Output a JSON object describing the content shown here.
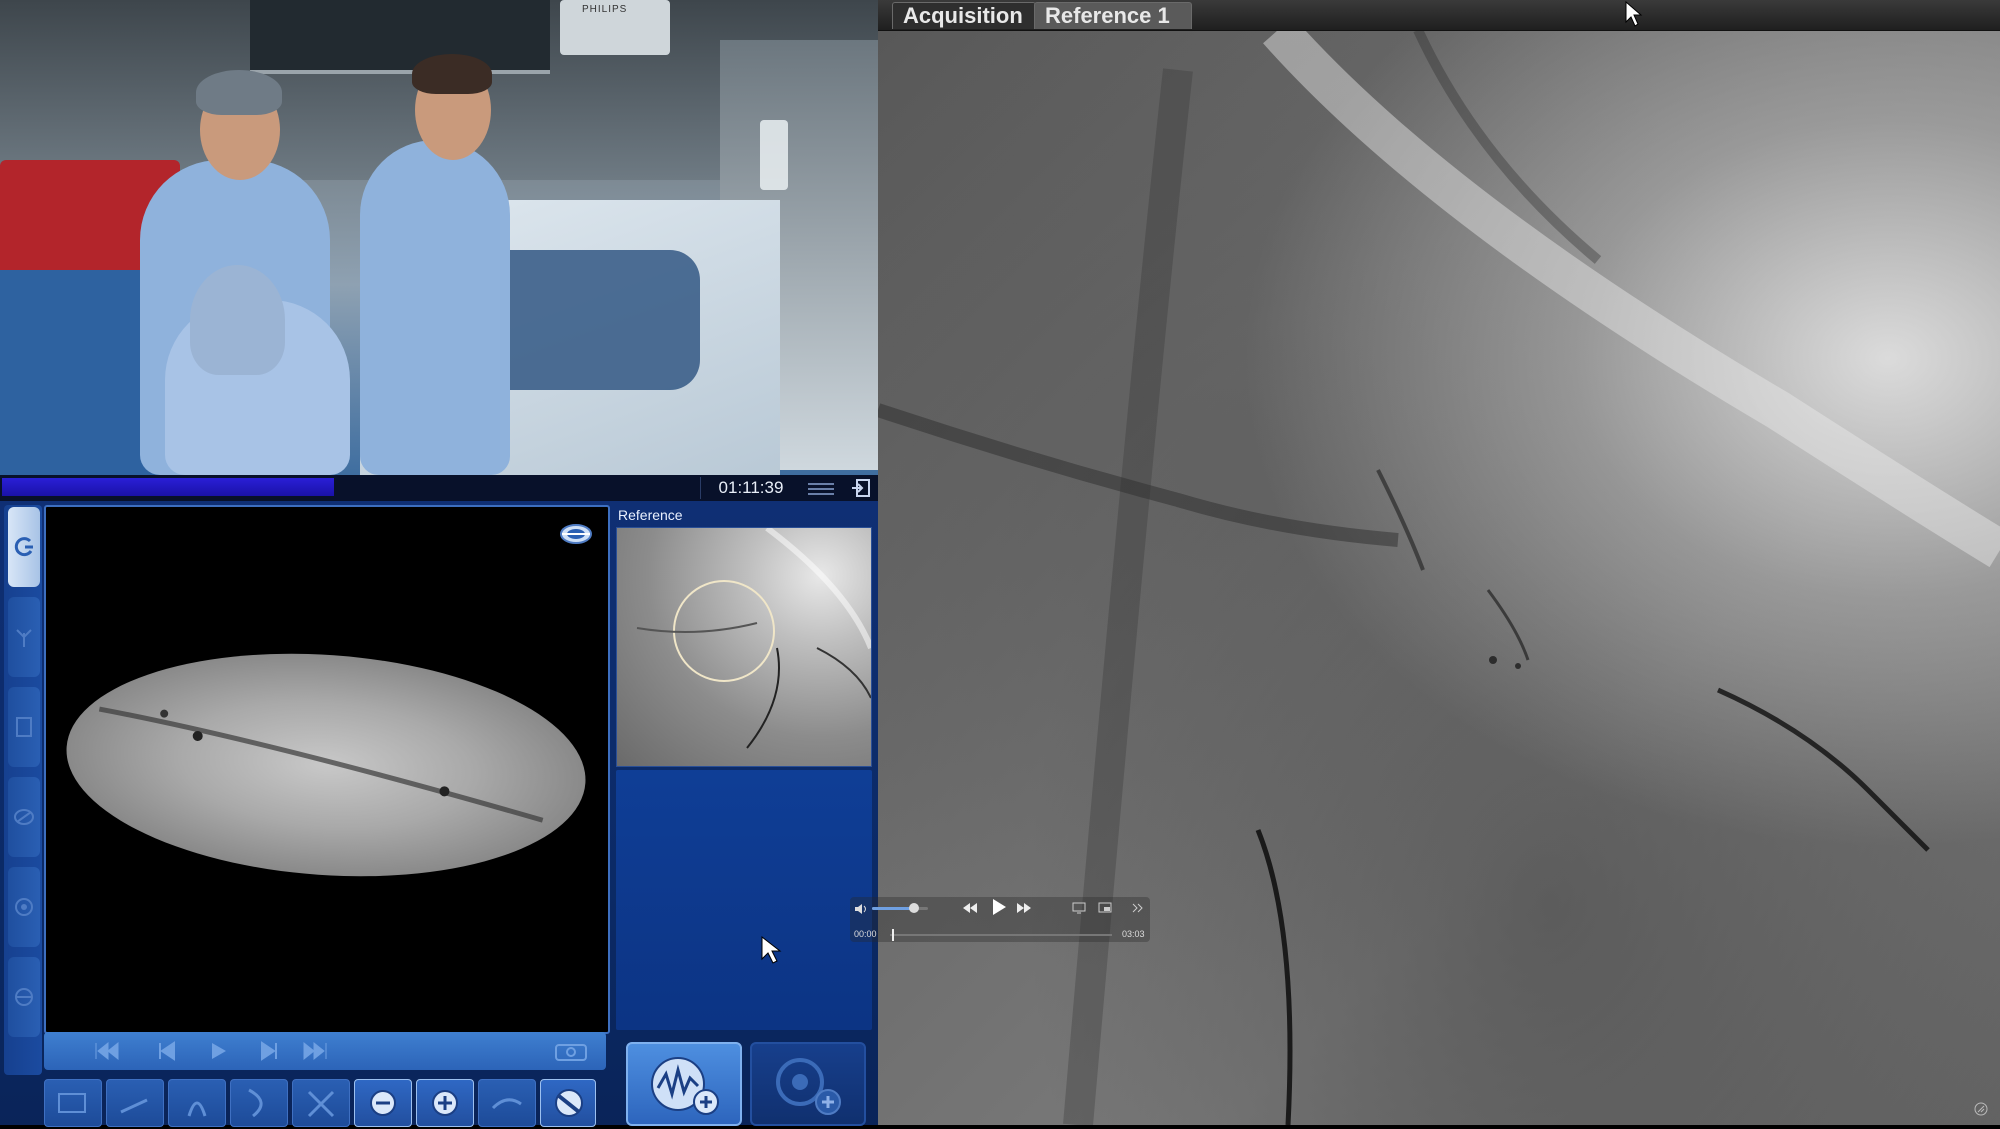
{
  "tabs": [
    {
      "label": "Acquisition"
    },
    {
      "label": "Reference 1"
    }
  ],
  "status": {
    "timer": "01:11:39",
    "progress_fraction": 0.38
  },
  "reference_panel": {
    "label": "Reference"
  },
  "camera_feed": {
    "equipment_brand": "PHILIPS"
  },
  "media_player": {
    "elapsed": "00:00",
    "duration": "03:03",
    "volume_fraction": 0.75,
    "position_fraction": 0.01
  },
  "colors": {
    "panel_blue": "#0f2f74",
    "progress_blue": "#2a1fd6",
    "accent_light_blue": "#4e8fe0"
  },
  "icons": {
    "left_toolbar": [
      "rotate-icon",
      "tree-icon",
      "document-icon",
      "ablation-icon",
      "circle-target-icon",
      "view-icon"
    ],
    "bottom_tools": [
      "view-3d-icon",
      "plane-icon",
      "anatomy-icon",
      "curve-icon",
      "cross-icon",
      "zoom-out-icon",
      "zoom-in-icon",
      "flow-icon",
      "catheter-icon"
    ]
  }
}
